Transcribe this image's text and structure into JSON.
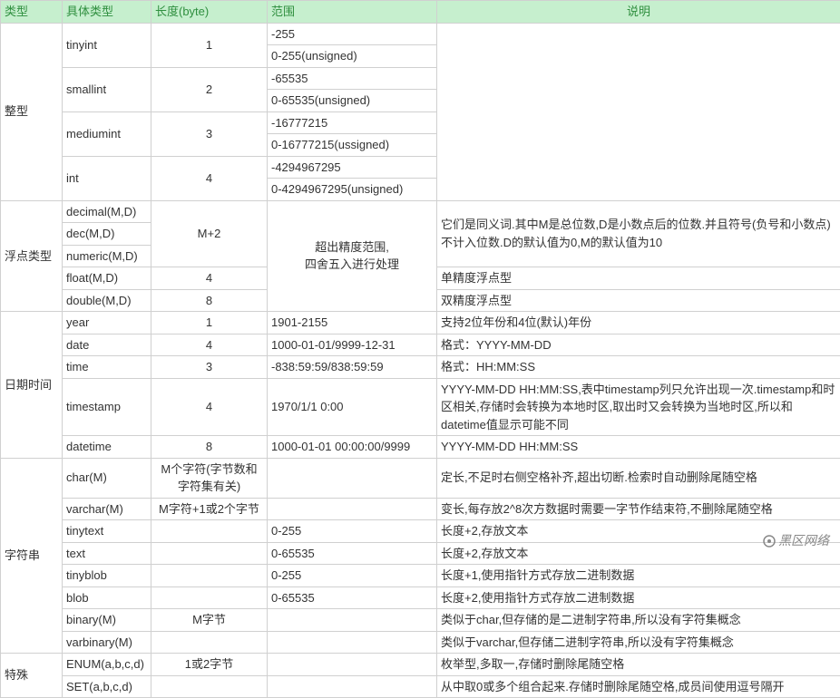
{
  "headers": {
    "type": "类型",
    "subtype": "具体类型",
    "length": "长度(byte)",
    "range": "范围",
    "desc": "说明"
  },
  "groups": [
    {
      "type": "整型",
      "rows": [
        {
          "subtype": "tinyint",
          "subtype_rowspan": 2,
          "length": "1",
          "length_rowspan": 2,
          "range": "-255",
          "desc": "",
          "desc_rowspan": 8
        },
        {
          "range": "0-255(unsigned)"
        },
        {
          "subtype": "smallint",
          "subtype_rowspan": 2,
          "length": "2",
          "length_rowspan": 2,
          "range": "-65535"
        },
        {
          "range": "0-65535(unsigned)"
        },
        {
          "subtype": "mediumint",
          "subtype_rowspan": 2,
          "length": "3",
          "length_rowspan": 2,
          "range": "-16777215"
        },
        {
          "range": "0-16777215(ussigned)"
        },
        {
          "subtype": "int",
          "subtype_rowspan": 2,
          "length": "4",
          "length_rowspan": 2,
          "range": "-4294967295"
        },
        {
          "range": "0-4294967295(unsigned)"
        }
      ]
    },
    {
      "type": "浮点类型",
      "rows": [
        {
          "subtype": "decimal(M,D)",
          "length": "M+2",
          "length_rowspan": 3,
          "range": "超出精度范围,\n四舍五入进行处理",
          "range_rowspan": 5,
          "desc": "它们是同义词.其中M是总位数,D是小数点后的位数.并且符号(负号和小数点)不计入位数.D的默认值为0,M的默认值为10",
          "desc_rowspan": 3
        },
        {
          "subtype": "dec(M,D)"
        },
        {
          "subtype": "numeric(M,D)"
        },
        {
          "subtype": "float(M,D)",
          "length": "4",
          "desc": "单精度浮点型"
        },
        {
          "subtype": "double(M,D)",
          "length": "8",
          "desc": "双精度浮点型"
        }
      ]
    },
    {
      "type": "日期时间",
      "rows": [
        {
          "subtype": "year",
          "length": "1",
          "range": "1901-2155",
          "desc": "支持2位年份和4位(默认)年份"
        },
        {
          "subtype": "date",
          "length": "4",
          "range": "1000-01-01/9999-12-31",
          "desc": "格式：YYYY-MM-DD"
        },
        {
          "subtype": "time",
          "length": "3",
          "range": "-838:59:59/838:59:59",
          "desc": "格式：HH:MM:SS"
        },
        {
          "subtype": "timestamp",
          "length": "4",
          "range": "1970/1/1 0:00",
          "desc": "YYYY-MM-DD HH:MM:SS,表中timestamp列只允许出现一次.timestamp和时区相关,存储时会转换为本地时区,取出时又会转换为当地时区,所以和datetime值显示可能不同"
        },
        {
          "subtype": "datetime",
          "length": "8",
          "range": "1000-01-01 00:00:00/9999",
          "desc": "YYYY-MM-DD HH:MM:SS"
        }
      ]
    },
    {
      "type": "字符串",
      "rows": [
        {
          "subtype": "char(M)",
          "length": "M个字符(字节数和字符集有关)",
          "range": "",
          "desc": "定长,不足时右侧空格补齐,超出切断.检索时自动删除尾随空格"
        },
        {
          "subtype": "varchar(M)",
          "length": "M字符+1或2个字节",
          "range": "",
          "desc": "变长,每存放2^8次方数据时需要一字节作结束符,不删除尾随空格"
        },
        {
          "subtype": "tinytext",
          "length": "",
          "range": "0-255",
          "desc": "长度+2,存放文本"
        },
        {
          "subtype": "text",
          "length": "",
          "range": "0-65535",
          "desc": "长度+2,存放文本"
        },
        {
          "subtype": "tinyblob",
          "length": "",
          "range": "0-255",
          "desc": "长度+1,使用指针方式存放二进制数据"
        },
        {
          "subtype": "blob",
          "length": "",
          "range": "0-65535",
          "desc": "长度+2,使用指针方式存放二进制数据"
        },
        {
          "subtype": "binary(M)",
          "length": "M字节",
          "range": "",
          "desc": "类似于char,但存储的是二进制字符串,所以没有字符集概念"
        },
        {
          "subtype": "varbinary(M)",
          "length": "",
          "range": "",
          "desc": "类似于varchar,但存储二进制字符串,所以没有字符集概念"
        }
      ]
    },
    {
      "type": "特殊",
      "rows": [
        {
          "subtype": "ENUM(a,b,c,d)",
          "length": "1或2字节",
          "range": "",
          "desc": "枚举型,多取一,存储时删除尾随空格"
        },
        {
          "subtype": "SET(a,b,c,d)",
          "length": "",
          "range": "",
          "desc": "从中取0或多个组合起来.存储时删除尾随空格,成员间使用逗号隔开"
        }
      ]
    }
  ],
  "watermark": "黑区网络"
}
